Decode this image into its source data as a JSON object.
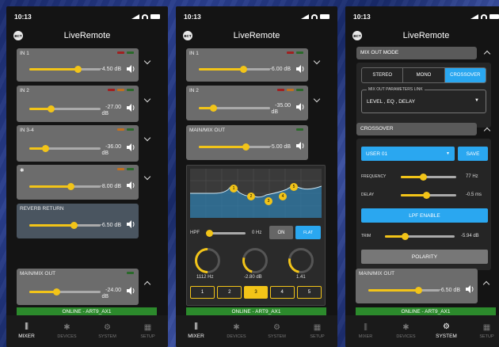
{
  "status": {
    "time": "10:13"
  },
  "app": {
    "title": "LiveRemote",
    "logo": "BCT"
  },
  "colors": {
    "accent": "#f2c418",
    "online": "#2c8a2c",
    "blue": "#2aa7f0"
  },
  "screen1": {
    "channels": [
      {
        "name": "IN 1",
        "value": "-4.50 dB",
        "level": 0.68
      },
      {
        "name": "IN 2",
        "value": "-27.00",
        "unit": "dB",
        "level": 0.3
      },
      {
        "name": "IN 3-4",
        "value": "-36.00",
        "unit": "dB",
        "level": 0.22
      },
      {
        "name": "",
        "value": "-8.00 dB",
        "level": 0.58
      },
      {
        "name": "REVERB RETURN",
        "value": "-6.50 dB",
        "level": 0.62
      }
    ],
    "main": {
      "name": "MAIN/MIX OUT",
      "value": "-24.00",
      "unit": "dB",
      "level": 0.38
    },
    "online": "ONLINE - ART9_AX1"
  },
  "screen2": {
    "channels": [
      {
        "name": "IN 1",
        "value": "-6.00 dB",
        "level": 0.62
      },
      {
        "name": "IN 2",
        "value": "-35.00",
        "unit": "dB",
        "level": 0.2
      }
    ],
    "main": {
      "name": "MAIN/MIX OUT",
      "value": "-5.00 dB",
      "level": 0.66
    },
    "eq": {
      "points": [
        "1",
        "2",
        "3",
        "4",
        "5"
      ]
    },
    "hpf": {
      "label": "HPF",
      "value": "0 Hz",
      "on": "ON",
      "flat": "FLAT"
    },
    "knobs": [
      {
        "value": "1112 Hz",
        "level": 0.45
      },
      {
        "value": "-2.80 dB",
        "level": 0.38
      },
      {
        "value": "1.41",
        "level": 0.35
      }
    ],
    "bands": [
      "1",
      "2",
      "3",
      "4",
      "5"
    ],
    "active_band": "3",
    "online": "ONLINE - ART9_AX1"
  },
  "screen3": {
    "mixout_header": "MIX OUT MODE",
    "modes": [
      "STEREO",
      "MONO",
      "CROSSOVER"
    ],
    "active_mode": "CROSSOVER",
    "link_label": "MIX OUT PARAMETERS LINK",
    "link_value": "LEVEL , EQ , DELAY",
    "crossover_header": "CROSSOVER",
    "user": "USER 01",
    "save": "SAVE",
    "frequency": {
      "label": "FREQUENCY",
      "value": "77 Hz",
      "level": 0.3
    },
    "delay": {
      "label": "DELAY",
      "value": "-0.5 ms",
      "level": 0.4
    },
    "lpf": "LPF ENABLE",
    "trim": {
      "label": "TRIM",
      "value": "-5.94 dB",
      "level": 0.3
    },
    "polarity": "POLARITY",
    "main": {
      "name": "MAIN/MIX OUT",
      "value": "-6.50 dB",
      "level": 0.7
    },
    "online": "ONLINE - ART9_AX1"
  },
  "tabs": [
    "MIXER",
    "DEVICES",
    "SYSTEM",
    "SETUP"
  ]
}
